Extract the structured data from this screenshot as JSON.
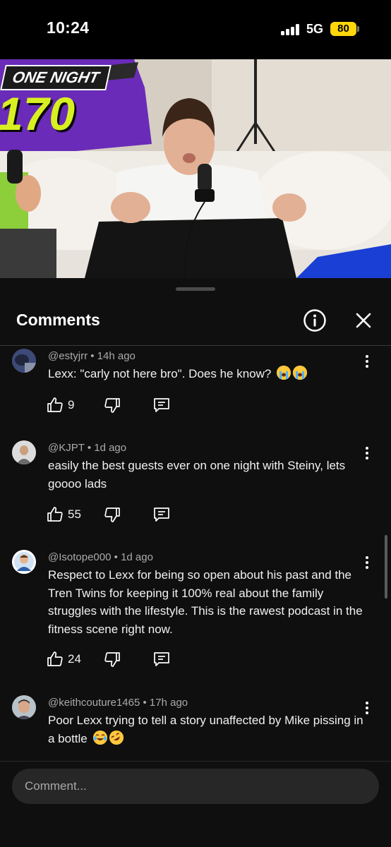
{
  "status_bar": {
    "time": "10:24",
    "network": "5G",
    "battery": "80",
    "battery_color": "#ffd60a"
  },
  "video": {
    "logo_text": "ONE NIGHT",
    "logo_number": "170"
  },
  "sheet": {
    "title": "Comments",
    "info_icon": "info-icon",
    "close_icon": "close-icon"
  },
  "comments": [
    {
      "author": "@estyjrr",
      "time": "14h ago",
      "text": "Lexx: \"carly not here bro\". Does he know?",
      "emojis": [
        "😭",
        "😭"
      ],
      "likes": "9"
    },
    {
      "author": "@KJPT",
      "time": "1d ago",
      "text": "easily the best guests ever on one night with Steiny, lets goooo lads",
      "emojis": [],
      "likes": "55"
    },
    {
      "author": "@Isotope000",
      "time": "1d ago",
      "text": "Respect to Lexx for being so open about his past and the Tren Twins for keeping it 100% real about the family struggles with the lifestyle. This is the rawest podcast in the fitness scene right now.",
      "emojis": [],
      "likes": "24"
    },
    {
      "author": "@keithcouture1465",
      "time": "17h ago",
      "text": "Poor Lexx trying to tell a story unaffected by Mike pissing in a bottle",
      "emojis": [
        "😂",
        "🤣"
      ],
      "likes": ""
    }
  ],
  "footer": {
    "placeholder": "Comment..."
  }
}
